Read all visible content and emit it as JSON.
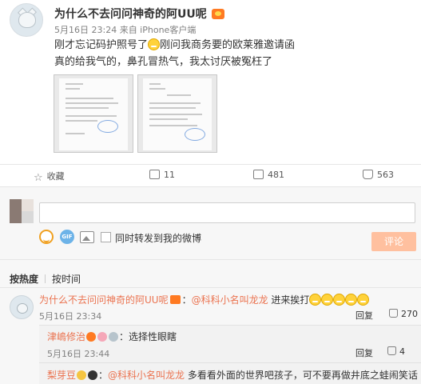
{
  "post": {
    "author": "为什么不去问问神奇的阿UU呢",
    "author_badge": "member-crown-icon",
    "time_source": "5月16日 23:24 来自 iPhone客户端",
    "content_line1_before": "刚才忘记码护照号了",
    "content_line1_after": "刚问我商务要的欧莱雅邀请函",
    "content_line2": "真的给我气的，鼻孔冒热气，我太讨厌被冤枉了",
    "emoji": "grin-emoji"
  },
  "actions": {
    "favorite_label": "收藏",
    "share_count": "11",
    "comment_count": "481",
    "like_count": "563"
  },
  "composer": {
    "input_value": "",
    "forward_label": "同时转发到我的微博",
    "submit_label": "评论",
    "gif_label": "GIF"
  },
  "sort": {
    "hot_label": "按热度",
    "time_label": "按时间"
  },
  "comments": [
    {
      "author": "为什么不去问问神奇的阿UU呢",
      "mention": "@科科小名叫龙龙",
      "text": " 进来挨打",
      "time": "5月16日 23:34",
      "reply_label": "回复",
      "likes": "270",
      "replies": [
        {
          "author": "津嶋修治",
          "text": "：选择性眼瞎",
          "time": "5月16日 23:44",
          "reply_label": "回复",
          "likes": "4"
        },
        {
          "author": "梨芽豆",
          "mention": "@科科小名叫龙龙",
          "text": " 多看看外面的世界吧孩子，可不要再做井底之蛙闹笑话"
        }
      ]
    }
  ],
  "colors": {
    "link": "#eb7350",
    "submit_disabled": "#ffc09f",
    "badge": "#ff7a22"
  }
}
